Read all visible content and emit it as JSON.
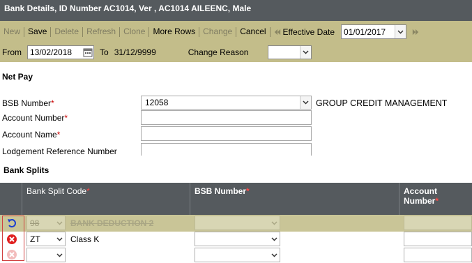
{
  "window": {
    "title": "Bank Details, ID Number AC1014, Ver , AC1014 AILEENC, Male"
  },
  "toolbar": {
    "new": "New",
    "save": "Save",
    "delete": "Delete",
    "refresh": "Refresh",
    "clone": "Clone",
    "more_rows": "More Rows",
    "change": "Change",
    "cancel": "Cancel",
    "effective_date_label": "Effective Date",
    "effective_date_value": "01/01/2017"
  },
  "range": {
    "from_label": "From",
    "from_value": "13/02/2018",
    "to_label": "To",
    "to_value": "31/12/9999",
    "change_reason_label": "Change Reason",
    "change_reason_value": ""
  },
  "netpay": {
    "section_title": "Net Pay",
    "bsb_label": "BSB Number",
    "bsb_value": "12058",
    "bsb_description": "GROUP CREDIT MANAGEMENT",
    "account_number_label": "Account Number",
    "account_number_value": "",
    "account_name_label": "Account Name",
    "account_name_value": "",
    "lodgement_label": "Lodgement Reference Number",
    "lodgement_value": "",
    "required_mark": "*"
  },
  "splits": {
    "section_title": "Bank Splits",
    "columns": [
      "Bank Split Code",
      "BSB Number",
      "Account Number"
    ],
    "required_mark": "*",
    "rows": [
      {
        "state": "deleted",
        "code": "98",
        "description": "BANK DEDUCTION 2",
        "bsb": "",
        "account": ""
      },
      {
        "state": "active",
        "code": "ZT",
        "description": "Class K",
        "bsb": "",
        "account": ""
      },
      {
        "state": "new",
        "code": "",
        "description": "",
        "bsb": "",
        "account": ""
      }
    ]
  },
  "colors": {
    "header_bg": "#555a5e",
    "toolbar_bg": "#c3bd8a",
    "deleted_row_bg": "#c9c597"
  }
}
